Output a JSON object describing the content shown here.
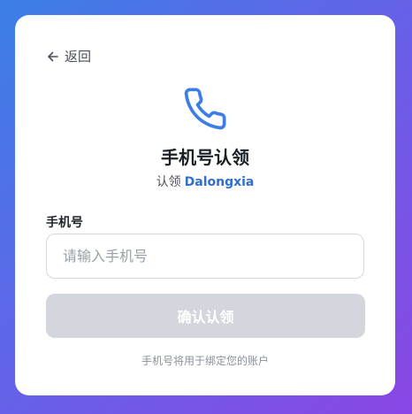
{
  "back": {
    "label": "返回",
    "icon": "arrow-left-icon"
  },
  "header": {
    "icon": "phone-icon",
    "title": "手机号认领",
    "subtitle_prefix": "认领",
    "account_name": "Dalongxia"
  },
  "form": {
    "phone_label": "手机号",
    "phone_placeholder": "请输入手机号",
    "phone_value": "",
    "submit_label": "确认认领",
    "submit_enabled": false,
    "hint": "手机号将用于绑定您的账户"
  },
  "colors": {
    "accent": "#2f6fd0",
    "icon": "#3c7ee6",
    "button_disabled": "#d3d6dc",
    "background_start": "#3b7fe6",
    "background_end": "#8a46e6"
  }
}
